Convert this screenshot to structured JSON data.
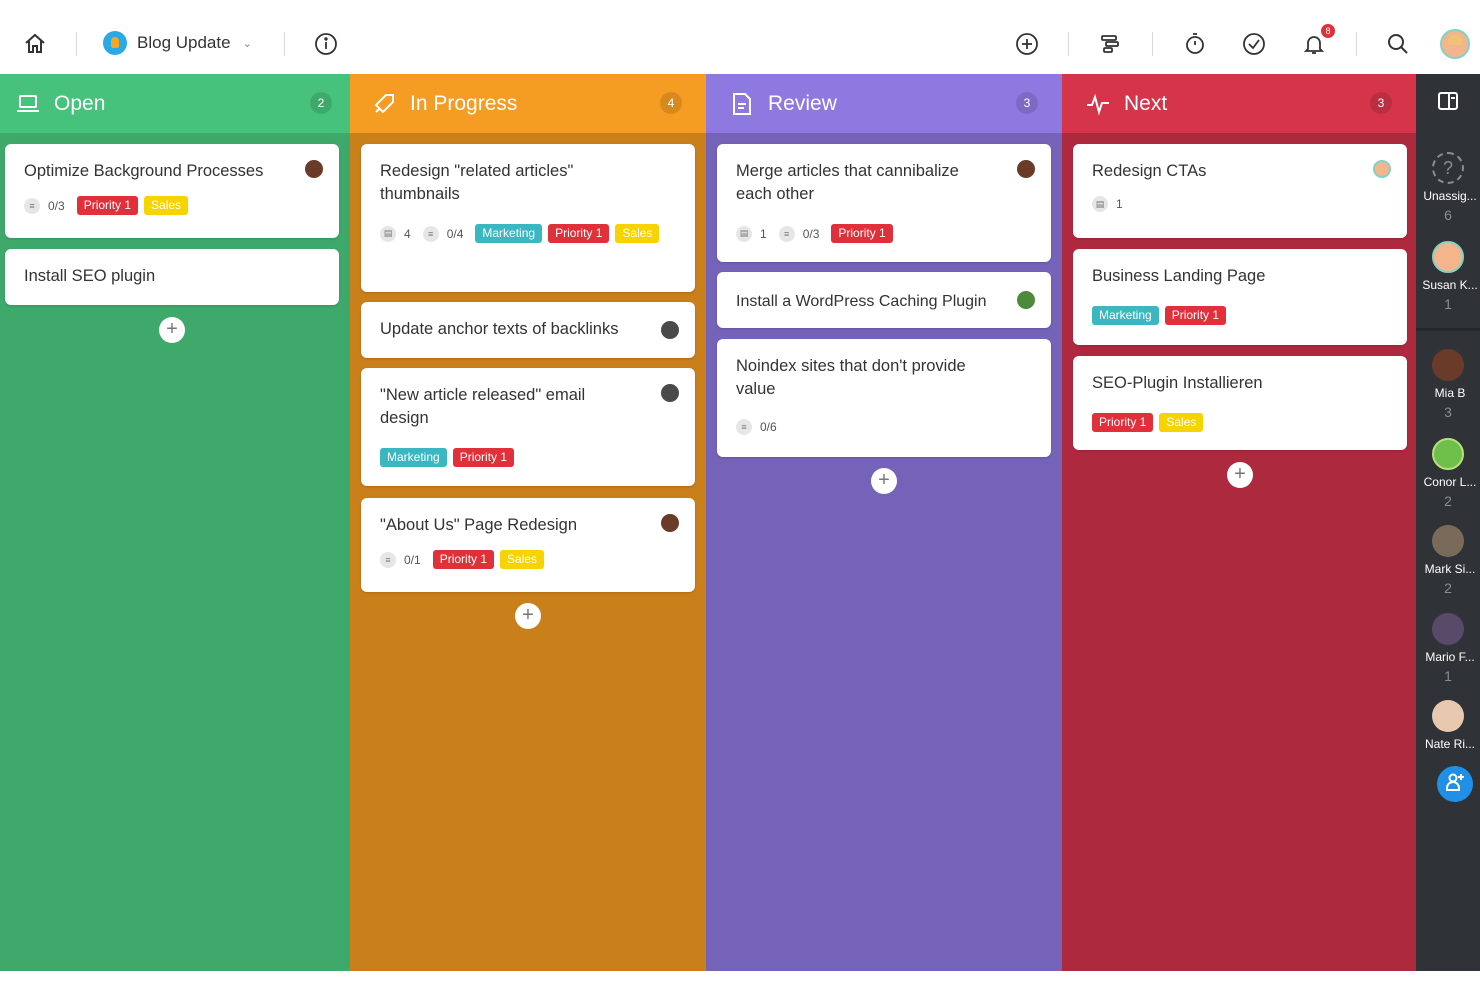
{
  "topbar": {
    "project_name": "Blog Update",
    "notification_count": "8"
  },
  "columns": [
    {
      "title": "Open",
      "count": "2",
      "color": "#3fa96b",
      "header_color": "#46c27c",
      "cards": [
        {
          "title": "Optimize Background Processes",
          "checklist": "0/3",
          "tags": [
            "Priority 1",
            "Sales"
          ]
        },
        {
          "title": "Install SEO plugin"
        }
      ]
    },
    {
      "title": "In Progress",
      "count": "4",
      "color": "#c97f1a",
      "header_color": "#f59c22",
      "cards": [
        {
          "title": "Redesign \"related articles\" thumbnails",
          "comments": "4",
          "checklist": "0/4",
          "tags": [
            "Marketing",
            "Priority 1",
            "Sales"
          ]
        },
        {
          "title": "Update anchor texts of backlinks"
        },
        {
          "title": "\"New article released\" email design",
          "tags": [
            "Marketing",
            "Priority 1"
          ]
        },
        {
          "title": "\"About Us\" Page Redesign",
          "checklist": "0/1",
          "tags": [
            "Priority 1",
            "Sales"
          ]
        }
      ]
    },
    {
      "title": "Review",
      "count": "3",
      "color": "#7463b8",
      "header_color": "#8e79e0",
      "cards": [
        {
          "title": "Merge articles that cannibalize each other",
          "comments": "1",
          "checklist": "0/3",
          "tags": [
            "Priority 1"
          ]
        },
        {
          "title": "Install a WordPress Caching Plugin"
        },
        {
          "title": "Noindex sites that don't provide value",
          "checklist": "0/6"
        }
      ]
    },
    {
      "title": "Next",
      "count": "3",
      "color": "#ad2a3e",
      "header_color": "#d5344a",
      "cards": [
        {
          "title": "Redesign CTAs",
          "comments": "1"
        },
        {
          "title": "Business Landing Page",
          "tags": [
            "Marketing",
            "Priority 1"
          ]
        },
        {
          "title": "SEO-Plugin Installieren",
          "tags": [
            "Priority 1",
            "Sales"
          ]
        }
      ]
    }
  ],
  "sidebar": {
    "users": [
      {
        "name": "Unassig...",
        "count": "6"
      },
      {
        "name": "Susan K...",
        "count": "1"
      },
      {
        "name": "Mia B",
        "count": "3"
      },
      {
        "name": "Conor L...",
        "count": "2"
      },
      {
        "name": "Mark Si...",
        "count": "2"
      },
      {
        "name": "Mario F...",
        "count": "1"
      },
      {
        "name": "Nate Ri...",
        "count": ""
      }
    ]
  }
}
